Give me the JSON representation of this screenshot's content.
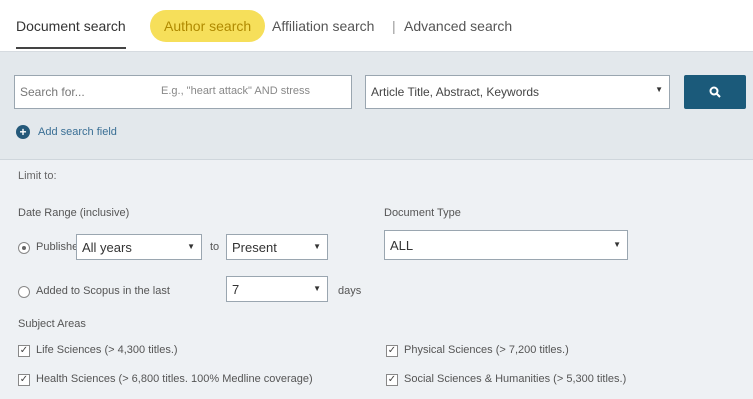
{
  "tabs": {
    "document": "Document search",
    "author": "Author search",
    "affiliation": "Affiliation search",
    "separator": "|",
    "advanced": "Advanced search"
  },
  "search": {
    "placeholder": "Search for...",
    "hint": "E.g., \"heart attack\" AND stress",
    "field": "Article Title, Abstract, Keywords",
    "button_icon": "search-icon"
  },
  "add_field": "Add search field",
  "limit_to": "Limit to:",
  "date_range": {
    "label": "Date Range (inclusive)",
    "published_label": "Published",
    "from": "All years",
    "to_label": "to",
    "to": "Present",
    "added_label": "Added to Scopus in the last",
    "added_value": "7",
    "days": "days"
  },
  "document_type": {
    "label": "Document Type",
    "value": "ALL"
  },
  "subject_areas": {
    "label": "Subject Areas",
    "items": [
      "Life Sciences (> 4,300 titles.)",
      "Physical Sciences (> 7,200 titles.)",
      "Health Sciences (> 6,800 titles. 100% Medline coverage)",
      "Social Sciences & Humanities (> 5,300 titles.)"
    ]
  },
  "colors": {
    "accent": "#1b5a7a",
    "highlight": "#f6df5a"
  }
}
